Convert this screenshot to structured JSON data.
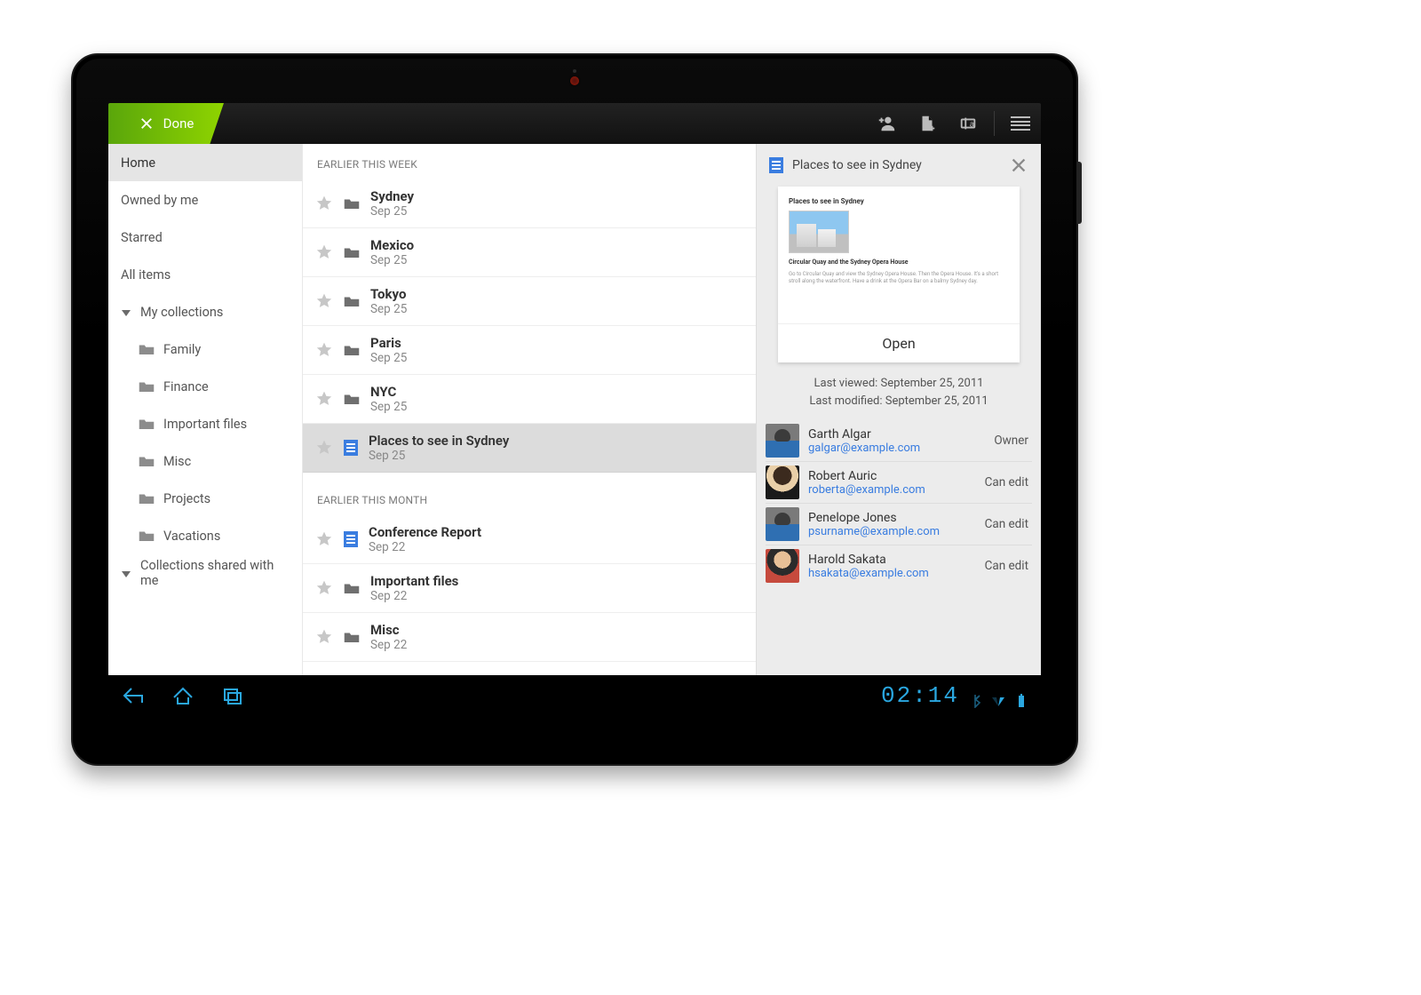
{
  "actionbar": {
    "done_label": "Done"
  },
  "sidebar": {
    "items": [
      {
        "label": "Home",
        "active": true
      },
      {
        "label": "Owned by me"
      },
      {
        "label": "Starred"
      },
      {
        "label": "All items"
      }
    ],
    "collections_header": "My collections",
    "collections": [
      {
        "label": "Family"
      },
      {
        "label": "Finance"
      },
      {
        "label": "Important files"
      },
      {
        "label": "Misc"
      },
      {
        "label": "Projects"
      },
      {
        "label": "Vacations"
      }
    ],
    "shared_header": "Collections shared with me"
  },
  "list": {
    "section_week": "EARLIER THIS WEEK",
    "section_month": "EARLIER THIS MONTH",
    "week": [
      {
        "title": "Sydney",
        "date": "Sep 25",
        "type": "folder"
      },
      {
        "title": "Mexico",
        "date": "Sep 25",
        "type": "folder"
      },
      {
        "title": "Tokyo",
        "date": "Sep 25",
        "type": "folder"
      },
      {
        "title": "Paris",
        "date": "Sep 25",
        "type": "folder"
      },
      {
        "title": "NYC",
        "date": "Sep 25",
        "type": "folder"
      },
      {
        "title": "Places to see in Sydney",
        "date": "Sep 25",
        "type": "doc",
        "selected": true
      }
    ],
    "month": [
      {
        "title": "Conference Report",
        "date": "Sep 22",
        "type": "doc"
      },
      {
        "title": "Important files",
        "date": "Sep 22",
        "type": "folder"
      },
      {
        "title": "Misc",
        "date": "Sep 22",
        "type": "folder"
      }
    ]
  },
  "details": {
    "title": "Places to see in Sydney",
    "preview_title": "Places to see in Sydney",
    "preview_heading": "Circular Quay and the Sydney Opera House",
    "open_label": "Open",
    "last_viewed": "Last viewed: September 25, 2011",
    "last_modified": "Last modified: September 25, 2011",
    "people": [
      {
        "name": "Garth Algar",
        "email": "galgar@example.com",
        "role": "Owner",
        "avatar": "droid"
      },
      {
        "name": "Robert Auric",
        "email": "roberta@example.com",
        "role": "Can edit",
        "avatar": "photo1"
      },
      {
        "name": "Penelope Jones",
        "email": "psurname@example.com",
        "role": "Can edit",
        "avatar": "droid"
      },
      {
        "name": "Harold Sakata",
        "email": "hsakata@example.com",
        "role": "Can edit",
        "avatar": "photo2"
      }
    ]
  },
  "navbar": {
    "time": "02:14"
  }
}
